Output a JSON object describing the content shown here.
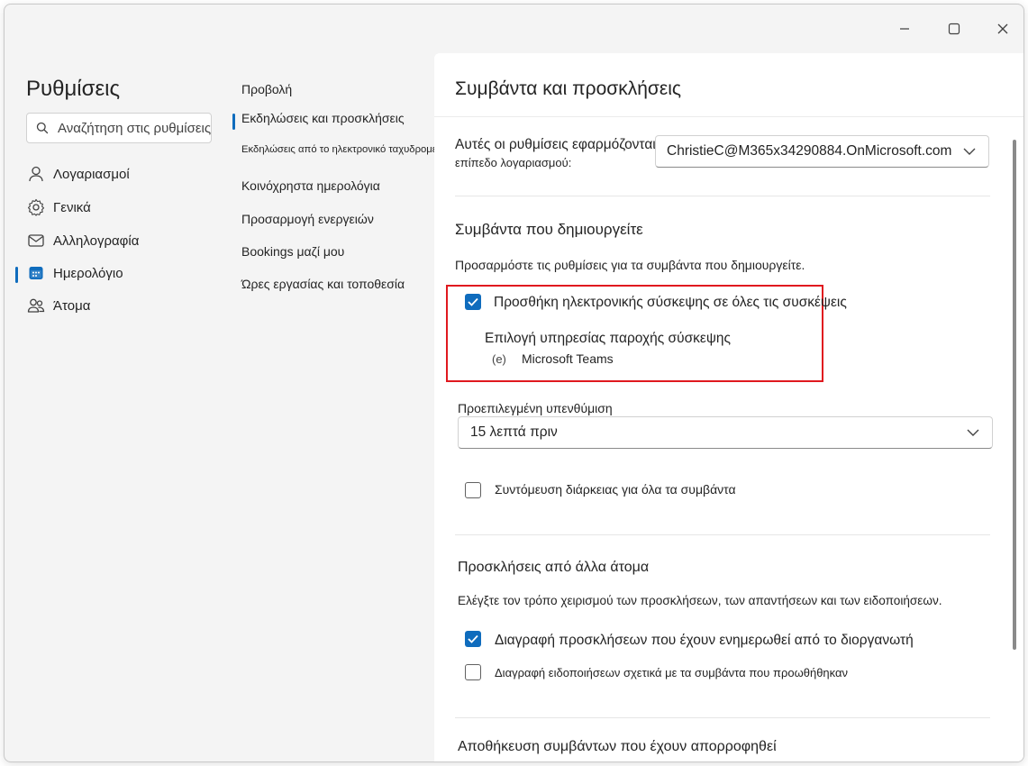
{
  "settings": {
    "title": "Ρυθμίσεις",
    "search_placeholder": "Αναζήτηση στις ρυθμίσεις"
  },
  "nav": {
    "items": [
      {
        "label": "Λογαριασμοί",
        "icon": "person-icon"
      },
      {
        "label": "Γενικά",
        "icon": "gear-icon"
      },
      {
        "label": "Αλληλογραφία",
        "icon": "mail-icon"
      },
      {
        "label": "Ημερολόγιο",
        "icon": "calendar-icon",
        "selected": true
      },
      {
        "label": "Άτομα",
        "icon": "people-icon"
      }
    ]
  },
  "subnav": {
    "items": [
      {
        "label": "Προβολή"
      },
      {
        "label": "Εκδηλώσεις και προσκλήσεις",
        "selected": true
      },
      {
        "label": "Εκδηλώσεις από το ηλεκτρονικό ταχυδρομείο"
      },
      {
        "label": "Κοινόχρηστα ημερολόγια"
      },
      {
        "label": "Προσαρμογή ενεργειών"
      },
      {
        "label": "Bookings μαζί μου"
      },
      {
        "label": "Ώρες εργασίας και τοποθεσία"
      }
    ]
  },
  "panel": {
    "title": "Συμβάντα και προσκλήσεις",
    "account_label_line1": "Αυτές οι ρυθμίσεις εφαρμόζονται σε",
    "account_label_line2": "επίπεδο λογαριασμού:",
    "account_value": "ChristieC@M365x34290884.OnMicrosoft.com",
    "events_section": {
      "heading": "Συμβάντα που δημιουργείτε",
      "description": "Προσαρμόστε τις ρυθμίσεις για τα συμβάντα που δημιουργείτε.",
      "add_online_meeting": {
        "label": "Προσθήκη ηλεκτρονικής σύσκεψης σε όλες τις συσκέψεις",
        "checked": true
      },
      "provider_label": "Επιλογή υπηρεσίας παροχής σύσκεψης",
      "provider_icon_text": "(e)",
      "provider_value": "Microsoft Teams",
      "reminder_label": "Προεπιλεγμένη υπενθύμιση",
      "reminder_value": "15 λεπτά πριν",
      "shorten_duration": {
        "label": "Συντόμευση διάρκειας για όλα τα συμβάντα",
        "checked": false
      }
    },
    "invitations_section": {
      "heading": "Προσκλήσεις από άλλα άτομα",
      "description": "Ελέγξτε τον τρόπο χειρισμού των προσκλήσεων, των απαντήσεων και των ειδοποιήσεων.",
      "delete_updated": {
        "label": "Διαγραφή προσκλήσεων που έχουν ενημερωθεί από το διοργανωτή",
        "checked": true
      },
      "delete_forwarded": {
        "label": "Διαγραφή ειδοποιήσεων σχετικά με τα συμβάντα που προωθήθηκαν",
        "checked": false
      }
    },
    "absorbed_section": {
      "heading": "Αποθήκευση συμβάντων που έχουν απορροφηθεί"
    }
  },
  "colors": {
    "accent": "#0f6cbd",
    "highlight": "#e0191f"
  }
}
